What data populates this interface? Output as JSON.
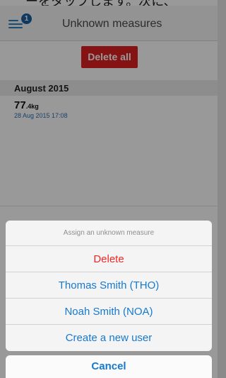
{
  "caption": "ーをタップします。次に、",
  "header": {
    "title": "Unknown measures",
    "badge_count": "1",
    "menu_icon": "menu-icon"
  },
  "toolbar": {
    "delete_all_label": "Delete all"
  },
  "sections": [
    {
      "title": "August 2015",
      "measures": [
        {
          "value_int": "77",
          "value_dec": ".4",
          "unit": "kg",
          "date": "28 Aug 2015 17:08"
        }
      ]
    }
  ],
  "action_sheet": {
    "title": "Assign an unknown measure",
    "items": [
      {
        "label": "Delete"
      },
      {
        "label": "Thomas Smith (THO)"
      },
      {
        "label": "Noah Smith (NOA)"
      },
      {
        "label": "Create a new user"
      }
    ],
    "cancel_label": "Cancel"
  },
  "colors": {
    "accent": "#1679d0",
    "destructive": "#f02828",
    "delete_button": "#e02020"
  }
}
